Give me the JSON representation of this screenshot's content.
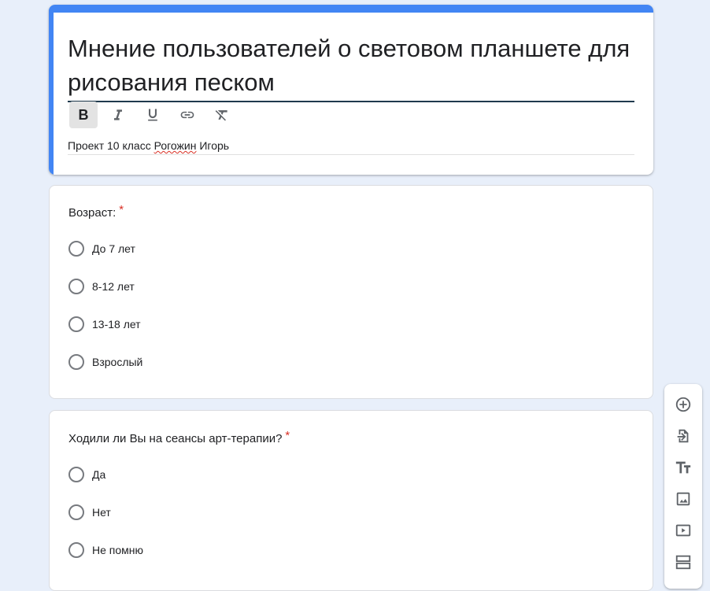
{
  "form": {
    "title": "Мнение пользователей о световом планшете для рисования песком",
    "description_part1": "Проект 10 класс ",
    "description_misspelled": "Рогожин",
    "description_part2": " Игорь",
    "toolbar": [
      "bold-icon",
      "italic-icon",
      "underline-icon",
      "link-icon",
      "clear-format-icon"
    ]
  },
  "questions": [
    {
      "title": "Возраст:",
      "required_mark": "*",
      "options": [
        "До 7 лет",
        "8-12 лет",
        "13-18 лет",
        "Взрослый"
      ]
    },
    {
      "title": "Ходили ли Вы на сеансы арт-терапии?",
      "required_mark": "*",
      "options": [
        "Да",
        "Нет",
        "Не помню"
      ]
    }
  ],
  "sidebar": [
    "add-question-icon",
    "import-questions-icon",
    "add-title-icon",
    "add-image-icon",
    "add-video-icon",
    "add-section-icon"
  ],
  "colors": {
    "accent": "#4285f4",
    "background": "#e8effa",
    "required": "#d93025"
  }
}
